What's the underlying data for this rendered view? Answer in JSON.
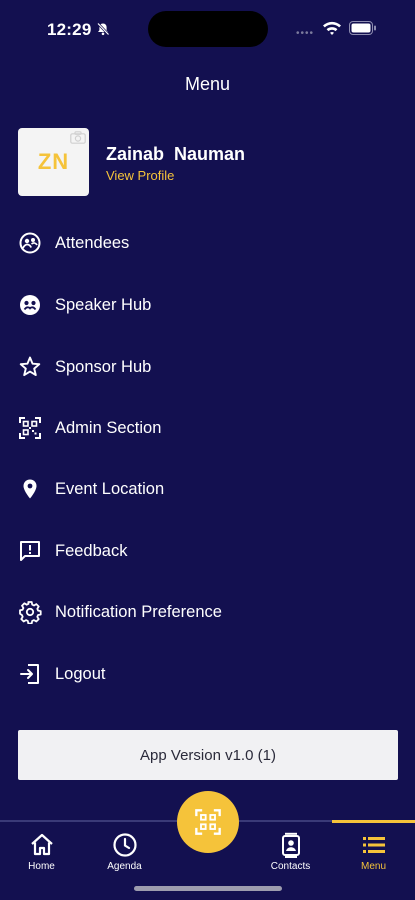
{
  "status": {
    "time": "12:29",
    "dots": "••••"
  },
  "header": {
    "title": "Menu"
  },
  "profile": {
    "initials": "ZN",
    "name": "Zainab  Nauman",
    "link": "View Profile"
  },
  "menu": {
    "items": [
      {
        "label": "Attendees",
        "icon": "attendees-icon"
      },
      {
        "label": "Speaker Hub",
        "icon": "speaker-icon"
      },
      {
        "label": "Sponsor Hub",
        "icon": "star-icon"
      },
      {
        "label": "Admin Section",
        "icon": "qr-scan-icon"
      },
      {
        "label": "Event Location",
        "icon": "location-pin-icon"
      },
      {
        "label": "Feedback",
        "icon": "feedback-icon"
      },
      {
        "label": "Notification Preference",
        "icon": "gear-icon"
      },
      {
        "label": "Logout",
        "icon": "logout-icon"
      }
    ]
  },
  "version": {
    "label": "App Version v1.0 (1)"
  },
  "tabs": [
    {
      "label": "Home",
      "icon": "home-icon"
    },
    {
      "label": "Agenda",
      "icon": "clock-icon"
    },
    {
      "label": "Contacts",
      "icon": "contacts-icon"
    },
    {
      "label": "Menu",
      "icon": "list-icon",
      "active": true
    }
  ],
  "colors": {
    "background": "#131050",
    "accent": "#f5c33a",
    "version_bg": "#f1f1f3"
  }
}
